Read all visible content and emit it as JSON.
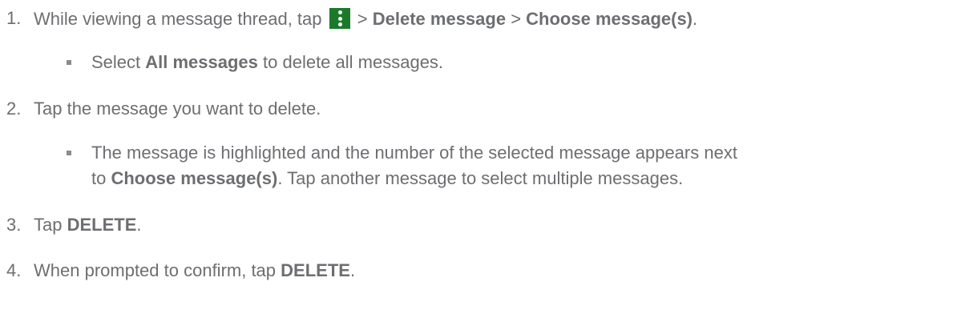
{
  "steps": [
    {
      "number": "1.",
      "text_before_icon": "While viewing a message thread, tap",
      "icon": "more-vertical-icon",
      "icon_color": "#1b7a2a",
      "sep1": " > ",
      "bold1": "Delete message",
      "sep2": " > ",
      "bold2": "Choose message(s)",
      "end": ".",
      "sub": {
        "pre": "Select ",
        "bold": "All messages",
        "post": " to delete all messages."
      }
    },
    {
      "number": "2.",
      "text": "Tap the message you want to delete.",
      "sub": {
        "line1": "The message is highlighted and the number of the selected message appears next",
        "line2_pre": "to ",
        "line2_bold": "Choose message(s)",
        "line2_post": ". Tap another message to select multiple messages."
      }
    },
    {
      "number": "3.",
      "pre": "Tap ",
      "bold": "DELETE",
      "post": "."
    },
    {
      "number": "4.",
      "pre": "When prompted to confirm, tap ",
      "bold": "DELETE",
      "post": "."
    }
  ]
}
